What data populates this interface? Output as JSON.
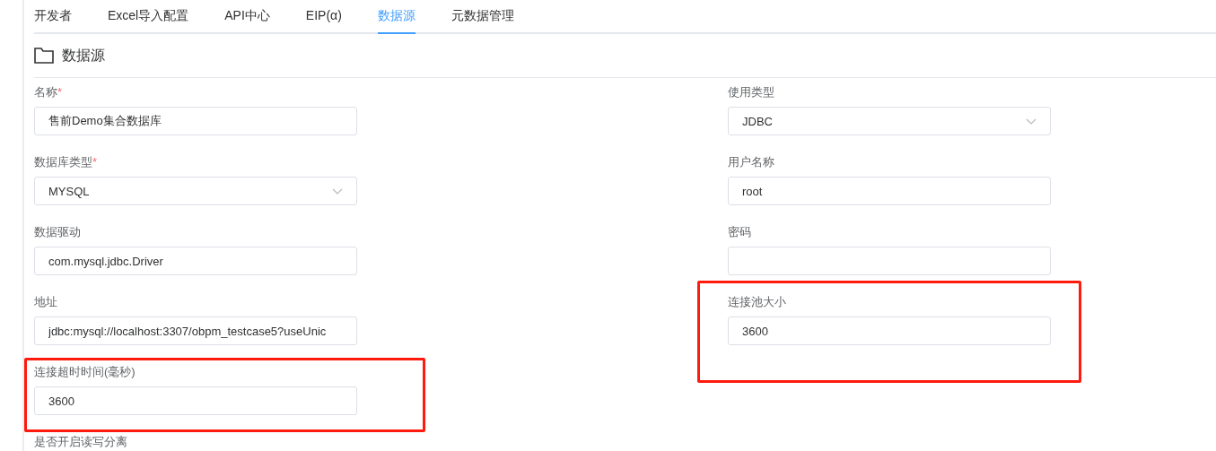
{
  "tabs": [
    {
      "label": "开发者",
      "selected": false
    },
    {
      "label": "Excel导入配置",
      "selected": false
    },
    {
      "label": "API中心",
      "selected": false
    },
    {
      "label": "EIP(α)",
      "selected": false
    },
    {
      "label": "数据源",
      "selected": true
    },
    {
      "label": "元数据管理",
      "selected": false
    }
  ],
  "section": {
    "title": "数据源"
  },
  "form": {
    "left_column": [
      {
        "kind": "input",
        "label": "名称",
        "required_mark": "*",
        "value": "售前Demo集合数据库"
      },
      {
        "kind": "select",
        "label": "数据库类型",
        "required_mark": "*",
        "value": "MYSQL"
      },
      {
        "kind": "input",
        "label": "数据驱动",
        "value": "com.mysql.jdbc.Driver"
      },
      {
        "kind": "input",
        "label": "地址",
        "value": "jdbc:mysql://localhost:3307/obpm_testcase5?useUnic"
      },
      {
        "kind": "input",
        "label": "连接超时时间(毫秒)",
        "value": "3600",
        "highlighted": true
      },
      {
        "kind": "label",
        "label": "是否开启读写分离"
      }
    ],
    "right_column": [
      {
        "kind": "select",
        "label": "使用类型",
        "value": "JDBC"
      },
      {
        "kind": "input",
        "label": "用户名称",
        "value": "root"
      },
      {
        "kind": "input",
        "label": "密码"
      },
      {
        "kind": "input",
        "label": "连接池大小",
        "value": "3600",
        "highlighted": true
      }
    ]
  }
}
